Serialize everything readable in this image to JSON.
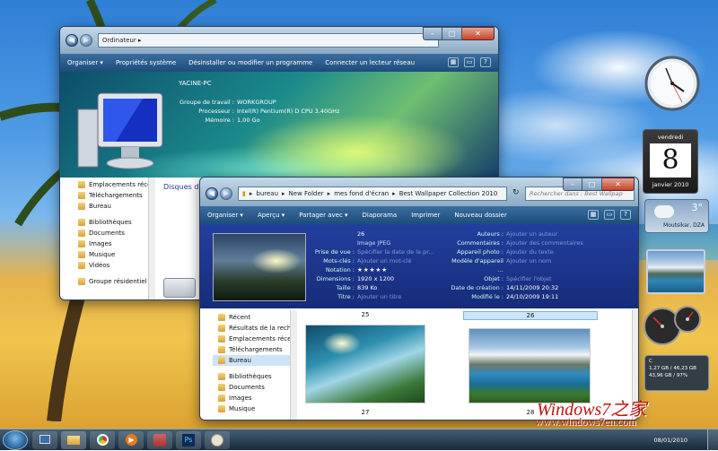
{
  "win1": {
    "address": "Ordinateur ▸",
    "toolbar": [
      "Organiser ▾",
      "Propriétés système",
      "Désinstaller ou modifier un programme",
      "Connecter un lecteur réseau"
    ],
    "computer_name": "YACINE-PC",
    "info": [
      {
        "label": "Groupe de travail :",
        "value": "WORKGROUP"
      },
      {
        "label": "Processeur :",
        "value": "Intel(R) Pentium(R) D CPU 3.40GHz"
      },
      {
        "label": "Mémoire :",
        "value": "1,00 Go"
      }
    ],
    "sidebar": [
      "Emplacements récer",
      "Téléchargements",
      "Bureau",
      "Bibliothèques",
      "Documents",
      "Images",
      "Musique",
      "Vidéos",
      "Groupe résidentiel"
    ],
    "section_header": "Disques du"
  },
  "win2": {
    "crumbs": [
      "bureau",
      "New Folder",
      "mes fond d'écran",
      "Best Wallpaper Collection 2010"
    ],
    "search_placeholder": "Rechercher dans : Best Wallpap",
    "toolbar": [
      "Organiser ▾",
      "Aperçu ▾",
      "Partager avec ▾",
      "Diaporama",
      "Imprimer",
      "Nouveau dossier"
    ],
    "details_left": [
      {
        "label": "",
        "value": "26"
      },
      {
        "label": "",
        "value": "Image JPEG"
      },
      {
        "label": "Prise de vue :",
        "value": "Spécifier la date de la pr..."
      },
      {
        "label": "Mots-clés :",
        "value": "Ajouter un mot-clé"
      },
      {
        "label": "Notation :",
        "value": "★★★★★"
      },
      {
        "label": "Dimensions :",
        "value": "1920 x 1200"
      },
      {
        "label": "Taille :",
        "value": "839 Ko"
      },
      {
        "label": "Titre :",
        "value": "Ajouter un titre"
      }
    ],
    "details_right": [
      {
        "label": "Auteurs :",
        "value": "Ajouter un auteur"
      },
      {
        "label": "Commentaires :",
        "value": "Ajouter des commentaires"
      },
      {
        "label": "Appareil photo :",
        "value": "Ajouter du texte"
      },
      {
        "label": "Modèle d'appareil ...",
        "value": "Ajouter un nom"
      },
      {
        "label": "Objet :",
        "value": "Spécifier l'objet"
      },
      {
        "label": "Date de création :",
        "value": "14/11/2009 20:32"
      },
      {
        "label": "Modifié le :",
        "value": "24/10/2009 19:11"
      }
    ],
    "sidebar": [
      "Récent",
      "Résultats de la reche",
      "Emplacements récer",
      "Téléchargements",
      "Bureau",
      "Bibliothèques",
      "Documents",
      "Images",
      "Musique"
    ],
    "files": [
      "25",
      "26",
      "27",
      "28"
    ]
  },
  "gadgets": {
    "calendar_day": "vendredi",
    "calendar_date": "8",
    "calendar_month": "janvier 2010",
    "weather_temp": "3°",
    "weather_city": "Moutsikar, DZA",
    "drive_label": "C",
    "drive_line1": "1,27 GB / 46,23 GB",
    "drive_line2": "43,96 GB / 97%"
  },
  "taskbar": {
    "date": "08/01/2010"
  },
  "watermark": {
    "logo": "Windows7之家",
    "url": "www.windows7en.com"
  }
}
